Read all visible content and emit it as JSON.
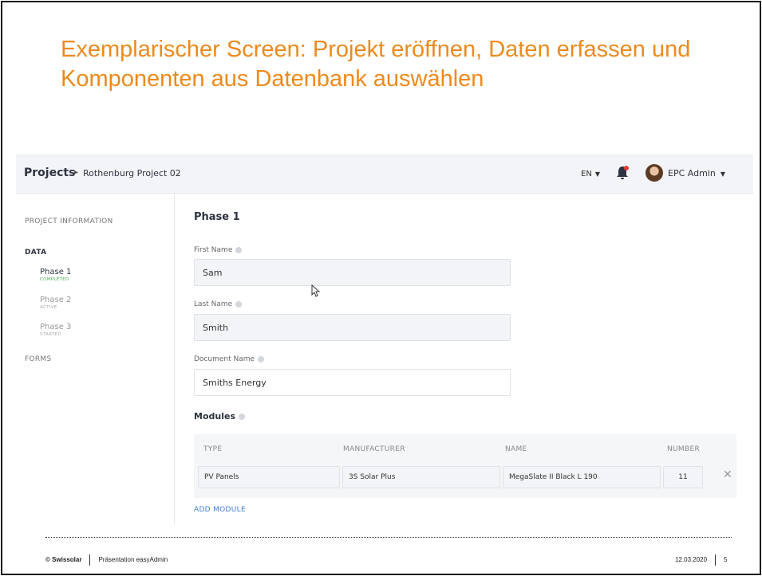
{
  "slide": {
    "title": "Exemplarischer Screen: Projekt eröffnen, Daten erfassen und Komponenten aus Datenbank auswählen",
    "accent_color": "#ee8a1d"
  },
  "header": {
    "breadcrumb_root": "Projects",
    "breadcrumb_sep": "▸",
    "breadcrumb_leaf": "Rothenburg Project 02",
    "language": "EN",
    "user_name": "EPC Admin",
    "icons": [
      "bell-icon",
      "avatar",
      "chevron-down-icon"
    ]
  },
  "sidebar": {
    "project_information": "PROJECT INFORMATION",
    "data": "DATA",
    "phases": [
      {
        "name": "Phase 1",
        "status": "COMPLETED"
      },
      {
        "name": "Phase 2",
        "status": "ACTIVE"
      },
      {
        "name": "Phase 3",
        "status": "STARTED"
      }
    ],
    "forms": "FORMS",
    "status_colors": {
      "completed": "#4caf50"
    }
  },
  "main": {
    "phase_title": "Phase 1",
    "first_name_label": "First Name",
    "first_name_value": "Sam",
    "last_name_label": "Last Name",
    "last_name_value": "Smith",
    "document_name_label": "Document Name",
    "document_name_value": "Smiths Energy",
    "modules_label": "Modules",
    "modules_table": {
      "columns": [
        "TYPE",
        "MANUFACTURER",
        "NAME",
        "NUMBER"
      ],
      "rows": [
        {
          "type": "PV Panels",
          "manufacturer": "3S Solar Plus",
          "name": "MegaSlate II Black L 190",
          "number": "11"
        }
      ],
      "remove_symbol": "✕"
    },
    "add_module": "ADD MODULE",
    "link_color": "#3f7fc9"
  },
  "footer": {
    "brand": "© Swissolar",
    "presentation": "Präsentation easyAdmin",
    "date": "12.03.2020",
    "page": "5"
  }
}
